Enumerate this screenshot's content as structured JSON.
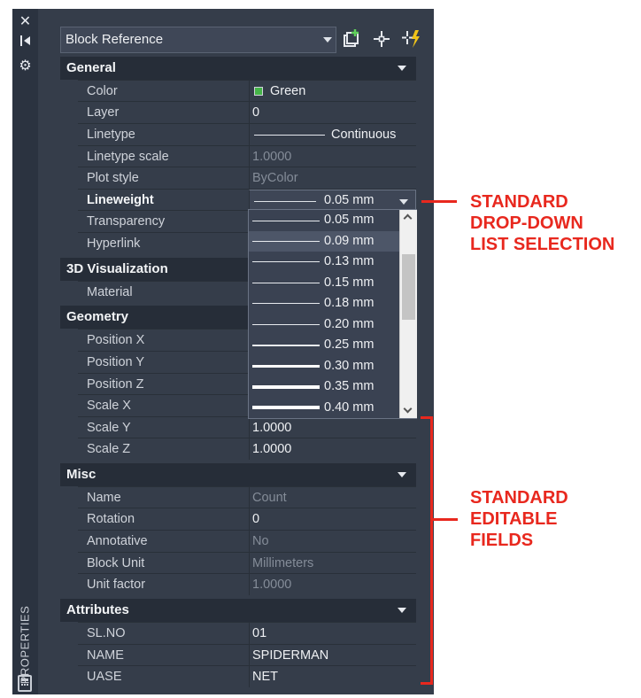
{
  "sidebar": {
    "close_glyph": "✕",
    "pin_glyph": "⧗",
    "settings_glyph": "⚙",
    "label": "PROPERTIES",
    "icons": [
      "close-icon",
      "auto-hide-icon",
      "settings-icon",
      "calculator-icon"
    ]
  },
  "selector": {
    "value": "Block Reference"
  },
  "toolbar": {
    "icons": [
      "toggle-pickadd-icon",
      "select-objects-icon",
      "quick-select-icon"
    ]
  },
  "categories": {
    "general": "General",
    "visualization": "3D Visualization",
    "geometry": "Geometry",
    "misc": "Misc",
    "attributes": "Attributes"
  },
  "general": {
    "color_label": "Color",
    "color_value": "Green",
    "layer_label": "Layer",
    "layer_value": "0",
    "linetype_label": "Linetype",
    "linetype_value": "Continuous",
    "linetype_scale_label": "Linetype scale",
    "linetype_scale_value": "1.0000",
    "plot_style_label": "Plot style",
    "plot_style_value": "ByColor",
    "lineweight_label": "Lineweight",
    "lineweight_value": "0.05 mm",
    "transparency_label": "Transparency",
    "hyperlink_label": "Hyperlink"
  },
  "visualization": {
    "material_label": "Material"
  },
  "geometry": {
    "posx_label": "Position X",
    "posy_label": "Position Y",
    "posz_label": "Position Z",
    "scalex_label": "Scale X",
    "scaley_label": "Scale Y",
    "scaley_value": "1.0000",
    "scalez_label": "Scale Z",
    "scalez_value": "1.0000"
  },
  "misc": {
    "name_label": "Name",
    "name_value": "Count",
    "rotation_label": "Rotation",
    "rotation_value": "0",
    "annotative_label": "Annotative",
    "annotative_value": "No",
    "block_unit_label": "Block Unit",
    "block_unit_value": "Millimeters",
    "unit_factor_label": "Unit factor",
    "unit_factor_value": "1.0000"
  },
  "attributes": {
    "slno_label": "SL.NO",
    "slno_value": "01",
    "name_label": "NAME",
    "name_value": "SPIDERMAN",
    "uase_label": "UASE",
    "uase_value": "NET"
  },
  "lineweight_options": [
    "0.05 mm",
    "0.09 mm",
    "0.13 mm",
    "0.15 mm",
    "0.18 mm",
    "0.20 mm",
    "0.25 mm",
    "0.30 mm",
    "0.35 mm",
    "0.40 mm"
  ],
  "annotations": {
    "dropdown_line1": "STANDARD",
    "dropdown_line2": "DROP-DOWN",
    "dropdown_line3": "LIST SELECTION",
    "fields_line1": "STANDARD",
    "fields_line2": "EDITABLE",
    "fields_line3": "FIELDS"
  },
  "colors": {
    "panel": "#353d4a",
    "category": "#262d38",
    "swatch_green": "#45b549",
    "annotation_red": "#e8281e"
  }
}
